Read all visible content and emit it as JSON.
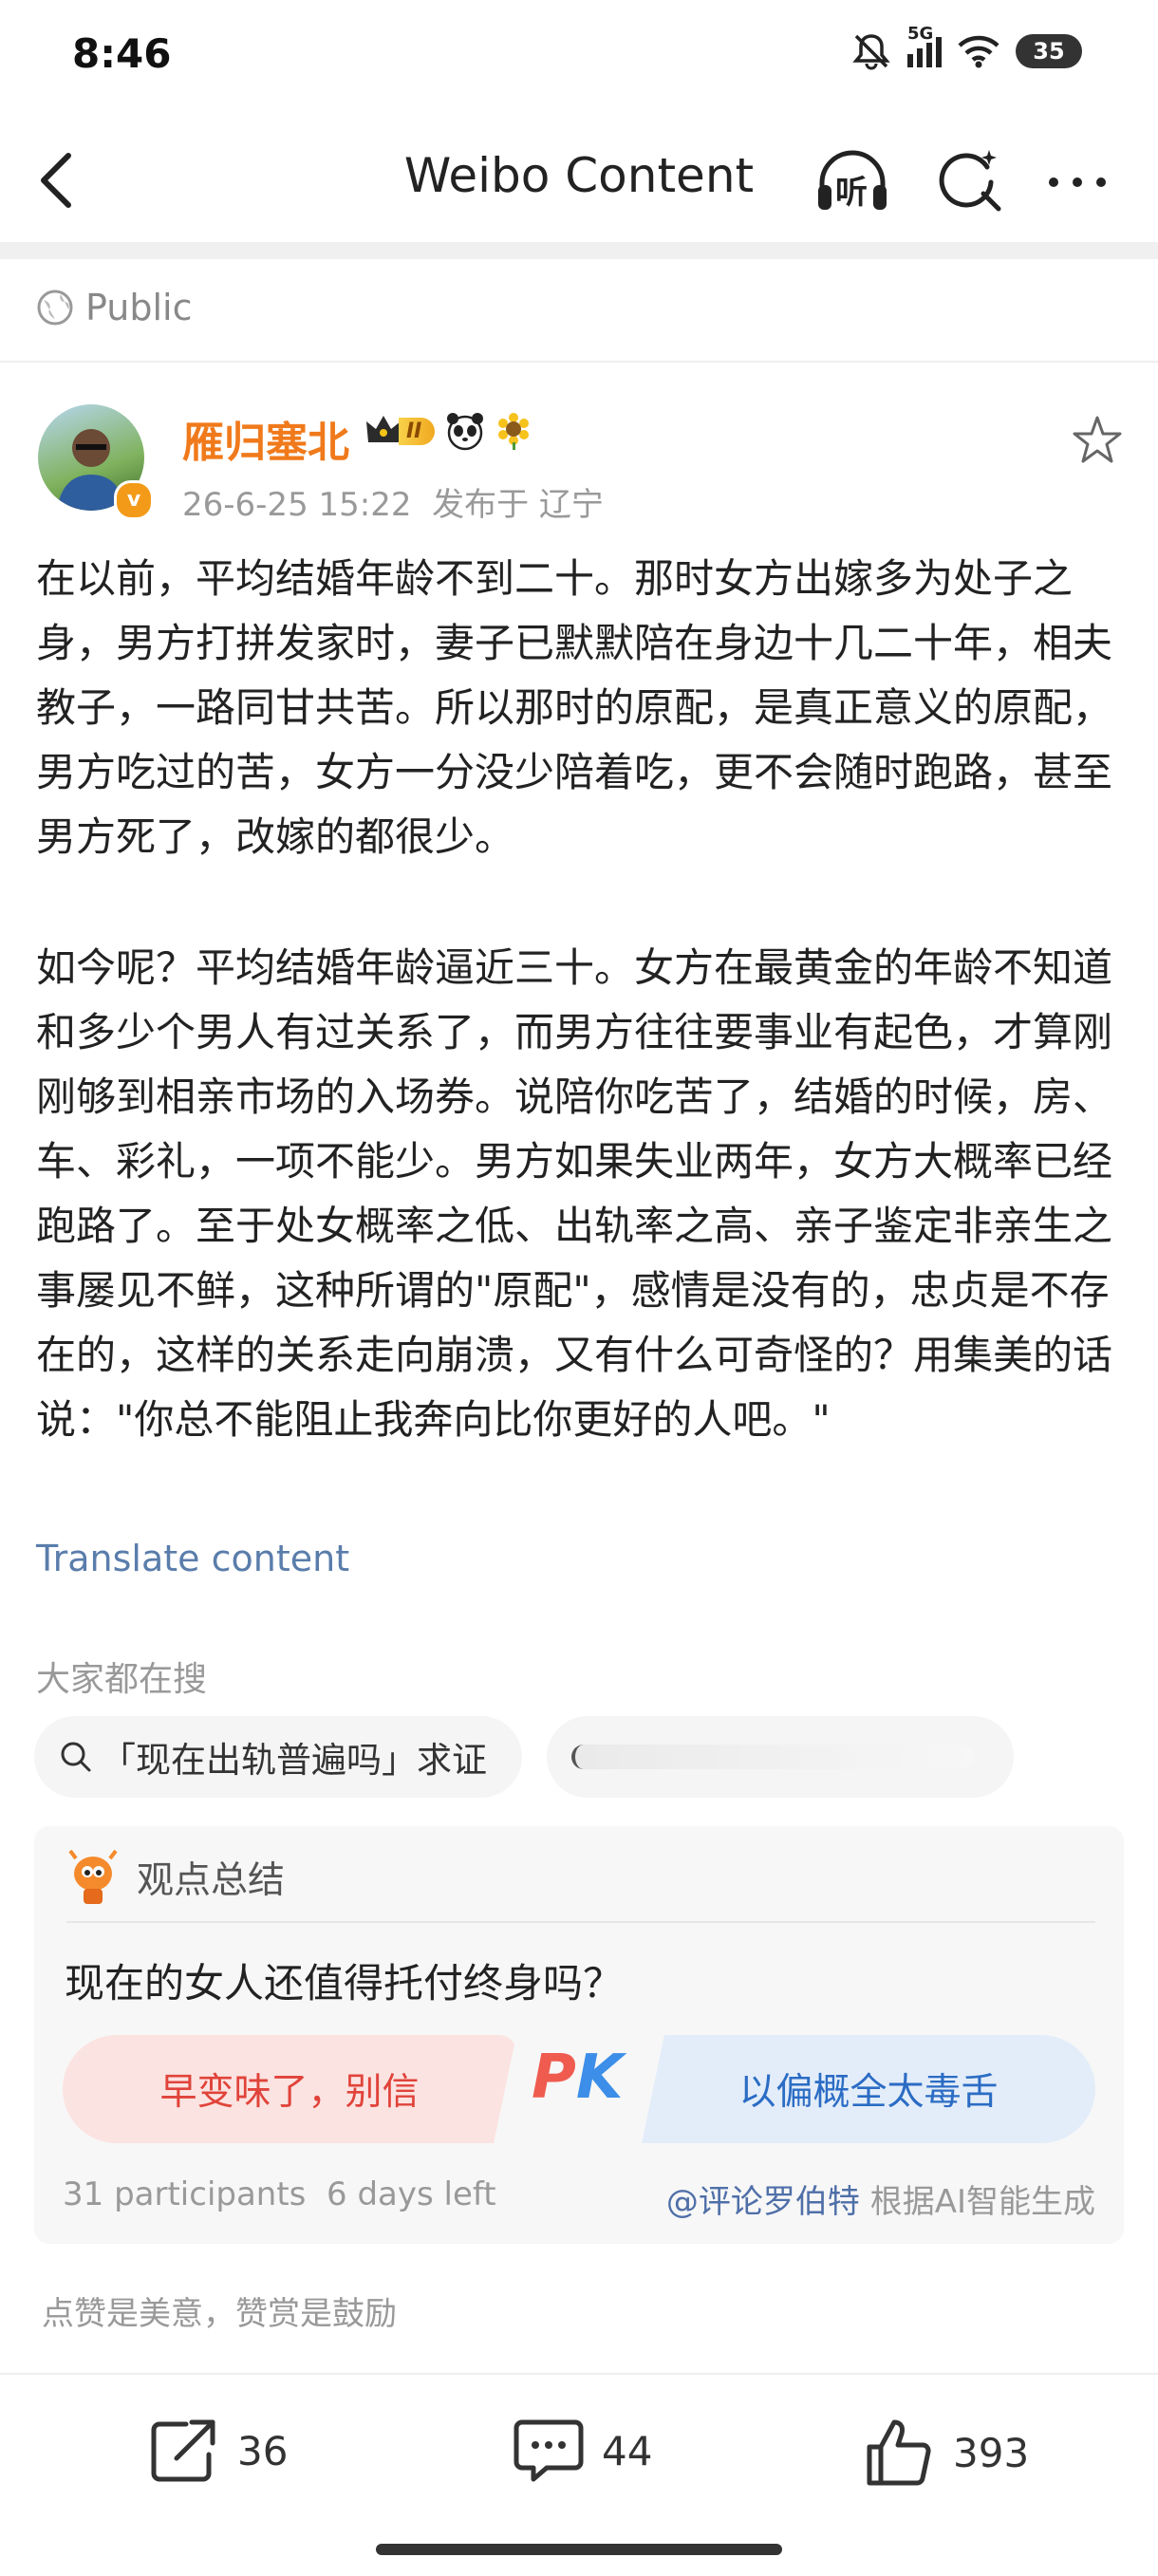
{
  "status_bar": {
    "time": "8:46",
    "network": "5G",
    "battery": "35"
  },
  "nav": {
    "title": "Weibo Content",
    "listen_label": "听"
  },
  "visibility": "Public",
  "author": {
    "name": "雁归塞北",
    "meta": "26-6-25 15:22  发布于 辽宁",
    "level": "II",
    "verified_mark": "v"
  },
  "post": {
    "paragraphs": [
      "在以前，平均结婚年龄不到二十。那时女方出嫁多为处子之身，男方打拼发家时，妻子已默默陪在身边十几二十年，相夫教子，一路同甘共苦。所以那时的原配，是真正意义的原配，男方吃过的苦，女方一分没少陪着吃，更不会随时跑路，甚至男方死了，改嫁的都很少。",
      "如今呢？平均结婚年龄逼近三十。女方在最黄金的年龄不知道和多少个男人有过关系了，而男方往往要事业有起色，才算刚刚够到相亲市场的入场券。说陪你吃苦了，结婚的时候，房、车、彩礼，一项不能少。男方如果失业两年，女方大概率已经跑路了。至于处女概率之低、出轨率之高、亲子鉴定非亲生之事屡见不鲜，这种所谓的\"原配\"，感情是没有的，忠贞是不存在的，这样的关系走向崩溃，又有什么可奇怪的？用集美的话说：\"你总不能阻止我奔向比你更好的人吧。\""
    ],
    "translate_label": "Translate content"
  },
  "hot_search": {
    "title": "大家都在搜",
    "chips": [
      "「现在出轨普遍吗」求证"
    ]
  },
  "viewpoint": {
    "title": "观点总结",
    "question": "现在的女人还值得托付终身吗？",
    "left_option": "早变味了，别信",
    "pk_p": "P",
    "pk_k": "K",
    "right_option": "以偏概全太毒舌",
    "participants": "31 participants  6 days left",
    "credit_account": "@评论罗伯特",
    "credit_suffix": " 根据AI智能生成"
  },
  "reward_text": "点赞是美意，赞赏是鼓励",
  "actions": {
    "share": "36",
    "comment": "44",
    "like": "393"
  },
  "colors": {
    "accent_orange": "#f07a1b",
    "link_blue": "#5a7dab",
    "pk_red": "#ef5b4f",
    "pk_blue": "#3c8ee8"
  }
}
